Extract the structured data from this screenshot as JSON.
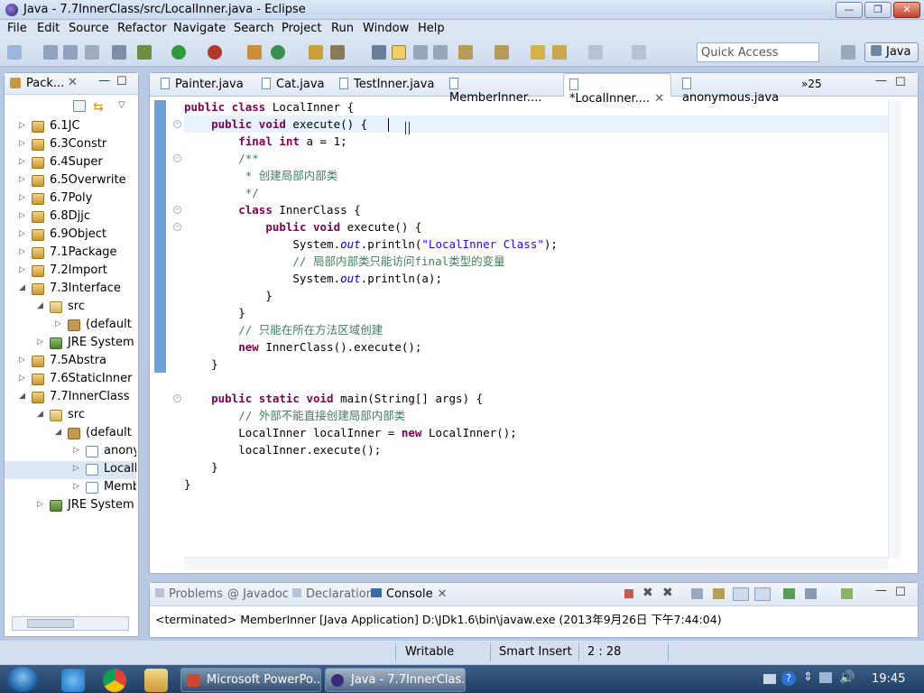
{
  "window": {
    "title": "Java - 7.7InnerClass/src/LocalInner.java - Eclipse",
    "min": "—",
    "max": "❐",
    "close": "✕"
  },
  "menu": [
    "File",
    "Edit",
    "Source",
    "Refactor",
    "Navigate",
    "Search",
    "Project",
    "Run",
    "Window",
    "Help"
  ],
  "toolbar": {
    "quick_access_placeholder": "Quick Access",
    "perspective": "Java"
  },
  "package_explorer": {
    "title": "Pack...",
    "items": [
      {
        "label": "6.1JC",
        "kind": "project",
        "expanded": false
      },
      {
        "label": "6.3Constr",
        "kind": "project",
        "expanded": false
      },
      {
        "label": "6.4Super",
        "kind": "project",
        "expanded": false
      },
      {
        "label": "6.5Overwrite",
        "kind": "project",
        "expanded": false
      },
      {
        "label": "6.7Poly",
        "kind": "project",
        "expanded": false
      },
      {
        "label": "6.8Djjc",
        "kind": "project",
        "expanded": false
      },
      {
        "label": "6.9Object",
        "kind": "project",
        "expanded": false
      },
      {
        "label": "7.1Package",
        "kind": "project",
        "expanded": false
      },
      {
        "label": "7.2Import",
        "kind": "project",
        "expanded": false
      },
      {
        "label": "7.3Interface",
        "kind": "project",
        "expanded": true
      },
      {
        "label": "src",
        "kind": "src",
        "expanded": true
      },
      {
        "label": "(default p",
        "kind": "package",
        "expanded": false
      },
      {
        "label": "JRE System L",
        "kind": "jre",
        "expanded": false
      },
      {
        "label": "7.5Abstra",
        "kind": "project",
        "expanded": false
      },
      {
        "label": "7.6StaticInner",
        "kind": "project",
        "expanded": false
      },
      {
        "label": "7.7InnerClass",
        "kind": "project",
        "expanded": true
      },
      {
        "label": "src",
        "kind": "src",
        "expanded": true
      },
      {
        "label": "(default p",
        "kind": "package",
        "expanded": true
      },
      {
        "label": "anony",
        "kind": "file",
        "expanded": false
      },
      {
        "label": "LocalI",
        "kind": "file",
        "expanded": false
      },
      {
        "label": "Memb",
        "kind": "file",
        "expanded": false
      },
      {
        "label": "JRE System L",
        "kind": "jre",
        "expanded": false
      }
    ],
    "selected_index": 19
  },
  "editor": {
    "tabs": [
      {
        "label": "Painter.java",
        "active": false
      },
      {
        "label": "Cat.java",
        "active": false
      },
      {
        "label": "TestInner.java",
        "active": false
      },
      {
        "label": "MemberInner....",
        "active": false
      },
      {
        "label": "*LocalInner....",
        "active": true
      },
      {
        "label": "anonymous.java",
        "active": false
      }
    ],
    "overflow": "»25",
    "code_lines": [
      [
        [
          "kw",
          "public class "
        ],
        [
          "",
          "LocalInner {"
        ]
      ],
      [
        [
          "",
          "    "
        ],
        [
          "kw",
          "public void "
        ],
        [
          "",
          "execute() {"
        ]
      ],
      [
        [
          "",
          "        "
        ],
        [
          "kw",
          "final int "
        ],
        [
          "",
          "a = 1;"
        ]
      ],
      [
        [
          "cm",
          "        /**"
        ]
      ],
      [
        [
          "cm",
          "         * 创建局部内部类"
        ]
      ],
      [
        [
          "cm",
          "         */"
        ]
      ],
      [
        [
          "",
          "        "
        ],
        [
          "kw",
          "class "
        ],
        [
          "",
          "InnerClass {"
        ]
      ],
      [
        [
          "",
          "            "
        ],
        [
          "kw",
          "public void "
        ],
        [
          "",
          "execute() {"
        ]
      ],
      [
        [
          "",
          "                System."
        ],
        [
          "it",
          "out"
        ],
        [
          "",
          ".println("
        ],
        [
          "st",
          "\"LocalInner Class\""
        ],
        [
          "",
          ");"
        ]
      ],
      [
        [
          "cm",
          "                // 局部内部类只能访问final类型的变量"
        ]
      ],
      [
        [
          "",
          "                System."
        ],
        [
          "it",
          "out"
        ],
        [
          "",
          ".println(a);"
        ]
      ],
      [
        [
          "",
          "            }"
        ]
      ],
      [
        [
          "",
          "        }"
        ]
      ],
      [
        [
          "cm",
          "        // 只能在所在方法区域创建"
        ]
      ],
      [
        [
          "",
          "        "
        ],
        [
          "kw",
          "new "
        ],
        [
          "",
          "InnerClass().execute();"
        ]
      ],
      [
        [
          "",
          "    }"
        ]
      ],
      [
        [
          "",
          ""
        ]
      ],
      [
        [
          "",
          "    "
        ],
        [
          "kw",
          "public static void "
        ],
        [
          "",
          "main(String[] args) {"
        ]
      ],
      [
        [
          "cm",
          "        // 外部不能直接创建局部内部类"
        ]
      ],
      [
        [
          "",
          "        LocalInner localInner = "
        ],
        [
          "kw",
          "new "
        ],
        [
          "",
          "LocalInner();"
        ]
      ],
      [
        [
          "",
          "        localInner.execute();"
        ]
      ],
      [
        [
          "",
          "    }"
        ]
      ],
      [
        [
          "",
          "}"
        ]
      ]
    ]
  },
  "console": {
    "tabs": [
      "Problems",
      "@ Javadoc",
      "Declaration",
      "Console"
    ],
    "active_tab": "Console",
    "output": "<terminated> MemberInner [Java Application] D:\\JDk1.6\\bin\\javaw.exe (2013年9月26日 下午7:44:04)"
  },
  "status": {
    "writable": "Writable",
    "insert_mode": "Smart Insert",
    "position": "2 : 28"
  },
  "taskbar": {
    "buttons": [
      "Microsoft PowerPo...",
      "Java - 7.7InnerClas..."
    ],
    "clock": "19:45"
  }
}
